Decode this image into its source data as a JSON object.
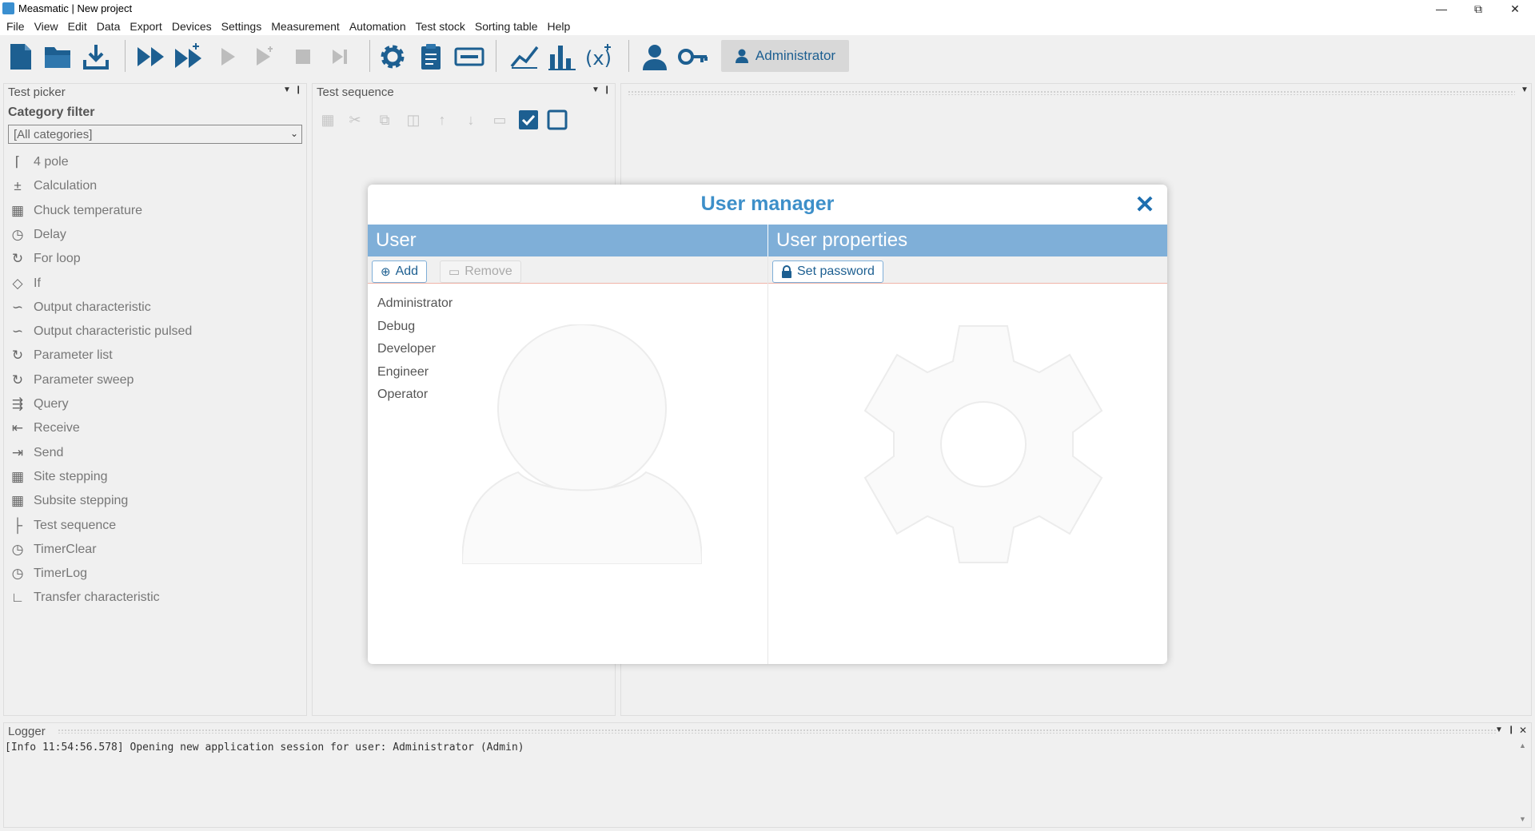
{
  "window": {
    "title": "Measmatic | New project",
    "controls": [
      "minimize",
      "restore",
      "close"
    ]
  },
  "menu": [
    "File",
    "View",
    "Edit",
    "Data",
    "Export",
    "Devices",
    "Settings",
    "Measurement",
    "Automation",
    "Test stock",
    "Sorting table",
    "Help"
  ],
  "toolbar": {
    "user_label": "Administrator"
  },
  "test_picker": {
    "title": "Test picker",
    "category_filter_label": "Category filter",
    "category_filter_value": "[All categories]",
    "items": [
      {
        "label": "4 pole",
        "icon": "chart-icon"
      },
      {
        "label": "Calculation",
        "icon": "calc-icon"
      },
      {
        "label": "Chuck temperature",
        "icon": "grid-circle-icon"
      },
      {
        "label": "Delay",
        "icon": "clock-icon"
      },
      {
        "label": "For loop",
        "icon": "loop-icon"
      },
      {
        "label": "If",
        "icon": "diamond-icon"
      },
      {
        "label": "Output characteristic",
        "icon": "curves-icon"
      },
      {
        "label": "Output characteristic pulsed",
        "icon": "curves-icon"
      },
      {
        "label": "Parameter list",
        "icon": "loop-icon"
      },
      {
        "label": "Parameter sweep",
        "icon": "loop-icon"
      },
      {
        "label": "Query",
        "icon": "query-icon"
      },
      {
        "label": "Receive",
        "icon": "receive-icon"
      },
      {
        "label": "Send",
        "icon": "send-icon"
      },
      {
        "label": "Site stepping",
        "icon": "grid-circle-icon"
      },
      {
        "label": "Subsite stepping",
        "icon": "grid-circle-icon"
      },
      {
        "label": "Test sequence",
        "icon": "tree-icon"
      },
      {
        "label": "TimerClear",
        "icon": "clock-icon"
      },
      {
        "label": "TimerLog",
        "icon": "clock-icon"
      },
      {
        "label": "Transfer characteristic",
        "icon": "curve-icon"
      }
    ]
  },
  "test_sequence": {
    "title": "Test sequence"
  },
  "logger": {
    "title": "Logger",
    "lines": [
      "[Info 11:54:56.578] Opening new application session for user: Administrator (Admin)"
    ]
  },
  "user_manager": {
    "title": "User manager",
    "user_column": {
      "header": "User",
      "add_label": "Add",
      "remove_label": "Remove",
      "users": [
        "Administrator",
        "Debug",
        "Developer",
        "Engineer",
        "Operator"
      ]
    },
    "properties_column": {
      "header": "User properties",
      "set_password_label": "Set password"
    }
  },
  "colors": {
    "accent": "#3d8fc9",
    "header_bg": "#7fafd8",
    "icon_blue": "#1d5f91"
  }
}
